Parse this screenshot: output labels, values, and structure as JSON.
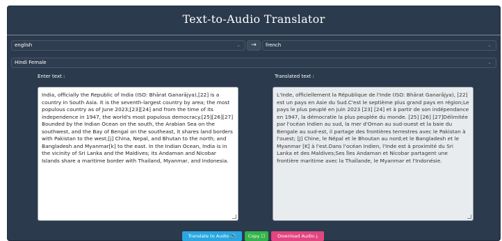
{
  "app": {
    "title": "Text-to-Audio Translator"
  },
  "language": {
    "source": "english",
    "target": "french",
    "swap_icon": "→"
  },
  "voice": {
    "selected": "Hindi Female"
  },
  "input": {
    "label": "Enter text :",
    "value": "India, officially the Republic of India (ISO: Bhārat Ganarājya),[22] is a country in South Asia. It is the seventh-largest country by area; the most populous country as of June 2023;[23][24] and from the time of its independence in 1947, the world's most populous democracy.[25][26][27] Bounded by the Indian Ocean on the south, the Arabian Sea on the southwest, and the Bay of Bengal on the southeast, it shares land borders with Pakistan to the west;[j] China, Nepal, and Bhutan to the north; and Bangladesh and Myanmar[k] to the east. In the Indian Ocean, India is in the vicinity of Sri Lanka and the Maldives; its Andaman and Nicobar Islands share a maritime border with Thailand, Myanmar, and Indonesia."
  },
  "output": {
    "label": "Translated text :",
    "value": "L'Inde, officiellement la République de l'Inde (ISO: Bhārat Ganarājya), [22] est un pays en Asie du Sud.C'est le septième plus grand pays en région;Le pays le plus peuplé en juin 2023 [23] [24] et à partir de son indépendance en 1947, la démocratie la plus peuplée du monde. [25] [26] [27]Délimitée par l'océan Indien au sud, la mer d'Oman au sud-ouest et la baie du Bengale au sud-est, il partage des frontières terrestres avec le Pakistan à l'ouest; [J] Chine, le Népal et le Bhoutan au nord;et le Bangladesh et le Myanmar [K] à l'est.Dans l'océan Indien, l'Inde est à proximité du Sri Lanka et des Maldives;Ses îles Andaman et Nicobar partagent une frontière maritime avec la Thaïlande, le Myanmar et l'Indonésie."
  },
  "buttons": {
    "translate": "Translate to Audio 🔊",
    "copy": "Copy ☐",
    "download": "Download Audio ⤓"
  },
  "colors": {
    "background": "#2b3a4d",
    "translate": "#2aa7e1",
    "copy": "#35b34a",
    "download": "#e2457f"
  }
}
